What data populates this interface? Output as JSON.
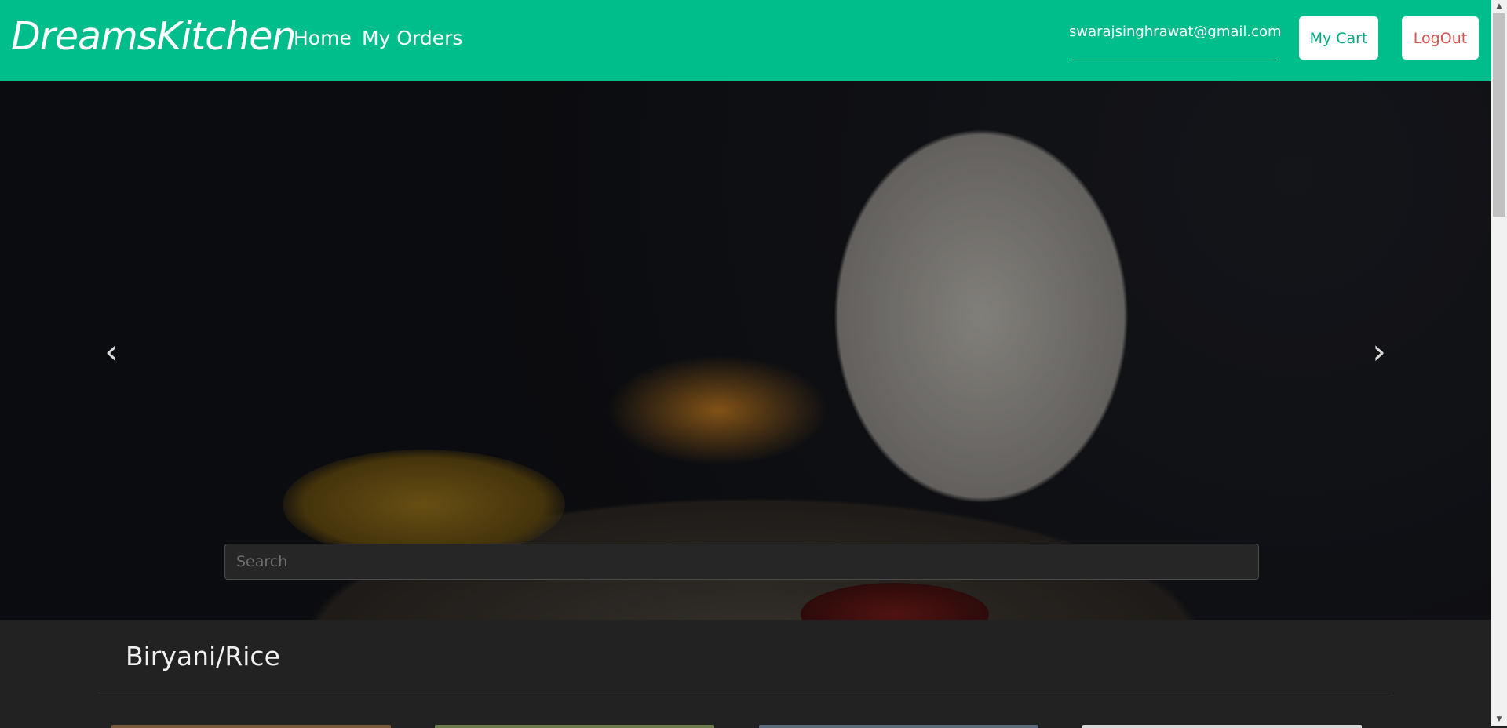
{
  "navbar": {
    "brand": "DreamsKitchen",
    "links": [
      "Home",
      "My Orders"
    ],
    "user_email": "swarajsinghrawat@gmail.com",
    "cart_label": "My Cart",
    "logout_label": "LogOut"
  },
  "hero": {
    "prev_icon": "chevron-left-icon",
    "next_icon": "chevron-right-icon",
    "prev_glyph": "‹",
    "next_glyph": "›",
    "search_placeholder": "Search"
  },
  "section": {
    "title": "Biryani/Rice"
  },
  "scrollbar": {
    "up_glyph": "▲",
    "down_glyph": "▼"
  },
  "colors": {
    "accent": "#00bd8c",
    "logout": "#d9534f",
    "background": "#222222"
  }
}
